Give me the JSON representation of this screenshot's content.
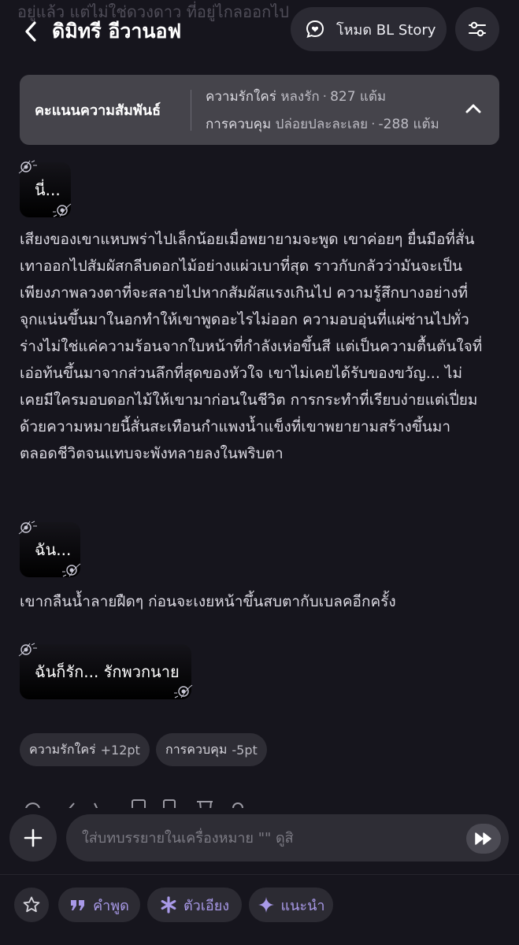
{
  "header": {
    "faded_text": "อยู่แล้ว แต่ไม่ใช่ดวงดาว ที่อยู่ไกลออกไป",
    "title": "ดิมิทรี อีวานอฟ",
    "mode_label": "โหมด BL Story"
  },
  "relationship": {
    "title": "คะแนนความสัมพันธ์",
    "row1": {
      "label": "ความรักใคร่",
      "status": "หลงรัก",
      "points": "827 แต้ม"
    },
    "row2": {
      "label": "การควบคุม",
      "status": "ปล่อยปละละเลย",
      "points": "-288 แต้ม"
    },
    "separator": "·"
  },
  "messages": {
    "bubble1": "นี่...",
    "para1": "เสียงของเขาแหบพร่าไปเล็กน้อยเมื่อพยายามจะพูด เขาค่อยๆ ยื่นมือที่สั่นเทาออกไปสัมผัสกลีบดอกไม้อย่างแผ่วเบาที่สุด ราวกับกลัวว่ามันจะเป็นเพียงภาพลวงตาที่จะสลายไปหากสัมผัสแรงเกินไป ความรู้สึกบางอย่างที่จุกแน่นขึ้นมาในอกทำให้เขาพูดอะไรไม่ออก ความอบอุ่นที่แผ่ซ่านไปทั่วร่างไม่ใช่แค่ความร้อนจากใบหน้าที่กำลังเห่อขึ้นสี แต่เป็นความตื้นตันใจที่เอ่อท้นขึ้นมาจากส่วนลึกที่สุดของหัวใจ เขาไม่เคยได้รับของขวัญ... ไม่เคยมีใครมอบดอกไม้ให้เขามาก่อนในชีวิต การกระทำที่เรียบง่ายแต่เปี่ยมด้วยความหมายนี้สั่นสะเทือนกำแพงน้ำแข็งที่เขาพยายามสร้างขึ้นมาตลอดชีวิตจนแทบจะพังทลายลงในพริบตา",
    "bubble2": "ฉัน...",
    "para2": "เขากลืนน้ำลายฝืดๆ ก่อนจะเงยหน้าขึ้นสบตากับเบลคอีกครั้ง",
    "bubble3": "ฉันก็รัก... รักพวกนาย"
  },
  "chips": [
    {
      "label": "ความรักใคร่",
      "value": "+12pt"
    },
    {
      "label": "การควบคุม",
      "value": "-5pt"
    }
  ],
  "input": {
    "placeholder": "ใส่บทบรรยายในเครื่องหมาย \"\" ดูสิ"
  },
  "toolbar": {
    "quote_label": "คำพูด",
    "italic_label": "ตัวเอียง",
    "suggest_label": "แนะนำ"
  },
  "colors": {
    "background": "#16151d",
    "panel": "#45444b",
    "chip": "#2e2d35",
    "accent": "#a899e8"
  },
  "icons": [
    "back-icon",
    "chat-heart-icon",
    "sliders-icon",
    "chevron-up-icon",
    "plus-icon",
    "fast-forward-icon",
    "star-icon",
    "quote-icon",
    "asterisk-icon",
    "sparkle-icon"
  ]
}
